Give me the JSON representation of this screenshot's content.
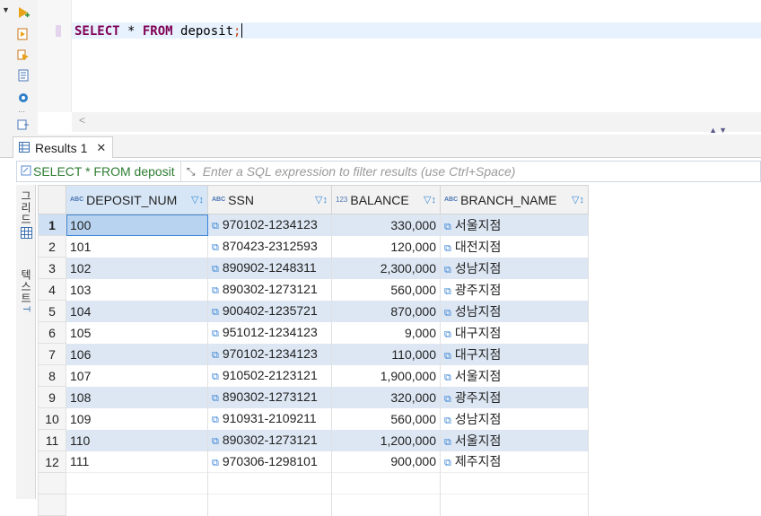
{
  "editor": {
    "sql_kw_select": "SELECT",
    "sql_star": " * ",
    "sql_kw_from": "FROM",
    "sql_table": " deposit",
    "sql_semicolon": ";"
  },
  "toolbar_icons": [
    "execute-icon",
    "execute-script-icon",
    "explain-plan-icon",
    "sql-file-icon",
    "settings-icon",
    "export-icon"
  ],
  "results": {
    "tab_label": "Results 1",
    "close_glyph": "✕",
    "filter_query": "SELECT * FROM deposit",
    "filter_placeholder": "Enter a SQL expression to filter results (use Ctrl+Space)"
  },
  "side_tabs": {
    "grid_label": "그리드",
    "text_label": "텍스트"
  },
  "grid": {
    "columns": [
      {
        "type": "ABC",
        "name": "DEPOSIT_NUM"
      },
      {
        "type": "ABC",
        "name": "SSN"
      },
      {
        "type": "123",
        "name": "BALANCE"
      },
      {
        "type": "ABC",
        "name": "BRANCH_NAME"
      }
    ],
    "rows": [
      {
        "n": "1",
        "deposit_num": "100",
        "ssn": "970102-1234123",
        "balance": "330,000",
        "branch": "서울지점"
      },
      {
        "n": "2",
        "deposit_num": "101",
        "ssn": "870423-2312593",
        "balance": "120,000",
        "branch": "대전지점"
      },
      {
        "n": "3",
        "deposit_num": "102",
        "ssn": "890902-1248311",
        "balance": "2,300,000",
        "branch": "성남지점"
      },
      {
        "n": "4",
        "deposit_num": "103",
        "ssn": "890302-1273121",
        "balance": "560,000",
        "branch": "광주지점"
      },
      {
        "n": "5",
        "deposit_num": "104",
        "ssn": "900402-1235721",
        "balance": "870,000",
        "branch": "성남지점"
      },
      {
        "n": "6",
        "deposit_num": "105",
        "ssn": "951012-1234123",
        "balance": "9,000",
        "branch": "대구지점"
      },
      {
        "n": "7",
        "deposit_num": "106",
        "ssn": "970102-1234123",
        "balance": "110,000",
        "branch": "대구지점"
      },
      {
        "n": "8",
        "deposit_num": "107",
        "ssn": "910502-2123121",
        "balance": "1,900,000",
        "branch": "서울지점"
      },
      {
        "n": "9",
        "deposit_num": "108",
        "ssn": "890302-1273121",
        "balance": "320,000",
        "branch": "광주지점"
      },
      {
        "n": "10",
        "deposit_num": "109",
        "ssn": "910931-2109211",
        "balance": "560,000",
        "branch": "성남지점"
      },
      {
        "n": "11",
        "deposit_num": "110",
        "ssn": "890302-1273121",
        "balance": "1,200,000",
        "branch": "서울지점"
      },
      {
        "n": "12",
        "deposit_num": "111",
        "ssn": "970306-1298101",
        "balance": "900,000",
        "branch": "제주지점"
      }
    ]
  }
}
